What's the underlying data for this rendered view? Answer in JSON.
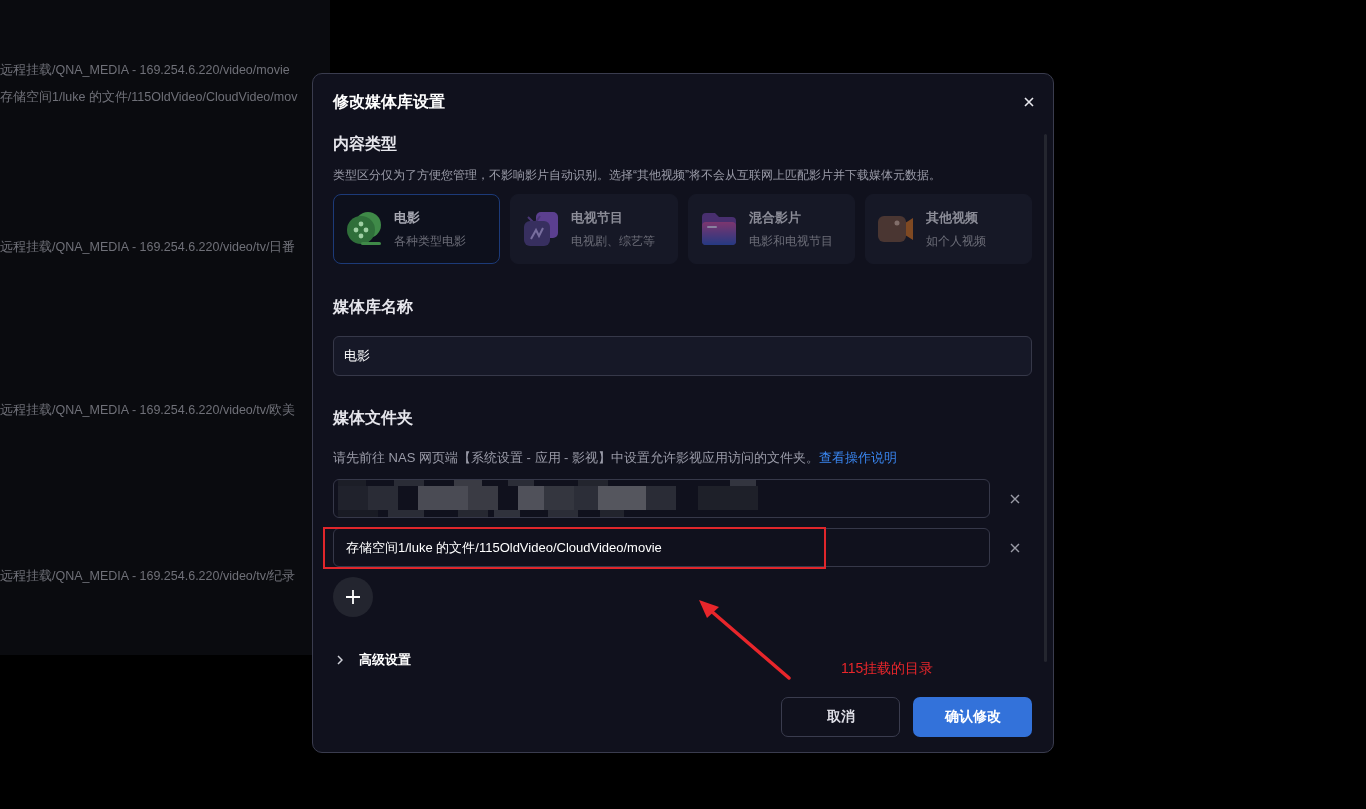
{
  "background_paths": [
    "远程挂载/QNA_MEDIA - 169.254.6.220/video/movie",
    "存储空间1/luke 的文件/115OldVideo/CloudVideo/mov",
    "远程挂载/QNA_MEDIA - 169.254.6.220/video/tv/日番",
    "远程挂载/QNA_MEDIA - 169.254.6.220/video/tv/欧美",
    "远程挂载/QNA_MEDIA - 169.254.6.220/video/tv/纪录"
  ],
  "dialog": {
    "title": "修改媒体库设置",
    "content_type": {
      "heading": "内容类型",
      "description": "类型区分仅为了方便您管理，不影响影片自动识别。选择“其他视频”将不会从互联网上匹配影片并下载媒体元数据。",
      "types": [
        {
          "kind": "movie",
          "title": "电影",
          "subtitle": "各种类型电影",
          "selected": true
        },
        {
          "kind": "tv",
          "title": "电视节目",
          "subtitle": "电视剧、综艺等",
          "selected": false
        },
        {
          "kind": "mixed",
          "title": "混合影片",
          "subtitle": "电影和电视节目",
          "selected": false
        },
        {
          "kind": "other",
          "title": "其他视频",
          "subtitle": "如个人视频",
          "selected": false
        }
      ]
    },
    "library_name": {
      "heading": "媒体库名称",
      "value": "电影"
    },
    "media_folders": {
      "heading": "媒体文件夹",
      "description": "请先前往 NAS 网页端【系统设置 - 应用 - 影视】中设置允许影视应用访问的文件夹。",
      "link": "查看操作说明",
      "folders": [
        {
          "kind": "redacted"
        },
        {
          "kind": "text",
          "value": "存储空间1/luke 的文件/115OldVideo/CloudVideo/movie"
        }
      ]
    },
    "advanced": {
      "label": "高级设置",
      "expanded": false
    },
    "buttons": [
      {
        "kind": "secondary",
        "label": "取消"
      },
      {
        "kind": "primary",
        "label": "确认修改"
      }
    ]
  },
  "annotation": {
    "text": "115挂载的目录"
  }
}
